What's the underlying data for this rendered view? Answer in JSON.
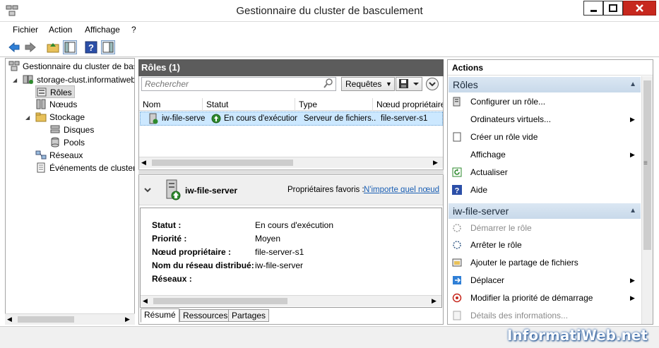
{
  "window": {
    "title": "Gestionnaire du cluster de basculement"
  },
  "menu": {
    "items": [
      "Fichier",
      "Action",
      "Affichage",
      "?"
    ]
  },
  "tree": {
    "root": "Gestionnaire du cluster de basculement",
    "cluster": "storage-clust.informatiweb.lan",
    "roles": "Rôles",
    "nodes": "Nœuds",
    "storage": "Stockage",
    "disks": "Disques",
    "pools": "Pools",
    "networks": "Réseaux",
    "events": "Événements de cluster"
  },
  "center": {
    "header": "Rôles (1)",
    "search_placeholder": "Rechercher",
    "queries_label": "Requêtes",
    "columns": [
      "Nom",
      "Statut",
      "Type",
      "Nœud propriétaire"
    ],
    "row": {
      "name": "iw-file-server",
      "status": "En cours d'exécution",
      "type": "Serveur de fichiers...",
      "owner": "file-server-s1"
    },
    "detail": {
      "title": "iw-file-server",
      "preferred_owners_label": "Propriétaires favoris :",
      "preferred_owners_link": "N'importe quel nœud",
      "fields": [
        {
          "label": "Statut :",
          "value": "En cours d'exécution"
        },
        {
          "label": "Priorité :",
          "value": "Moyen"
        },
        {
          "label": "Nœud propriétaire :",
          "value": "file-server-s1"
        },
        {
          "label": "Nom du réseau distribué:",
          "value": "iw-file-server"
        },
        {
          "label": "Réseaux :",
          "value": ""
        }
      ]
    },
    "tabs": [
      "Résumé",
      "Ressources",
      "Partages"
    ]
  },
  "actions": {
    "title": "Actions",
    "section1": "Rôles",
    "section1_items": [
      "Configurer un rôle...",
      "Ordinateurs virtuels...",
      "Créer un rôle vide",
      "Affichage",
      "Actualiser",
      "Aide"
    ],
    "section2": "iw-file-server",
    "section2_items": [
      "Démarrer le rôle",
      "Arrêter le rôle",
      "Ajouter le partage de fichiers",
      "Déplacer",
      "Modifier la priorité de démarrage",
      "Détails des informations..."
    ]
  },
  "watermark": "InformatiWeb.net",
  "colors": {
    "header_dark": "#5c5c5c",
    "section_blue": "#c8d9ea",
    "selection": "#cce8ff",
    "link": "#1a5fb4",
    "close_red": "#c7281e"
  }
}
